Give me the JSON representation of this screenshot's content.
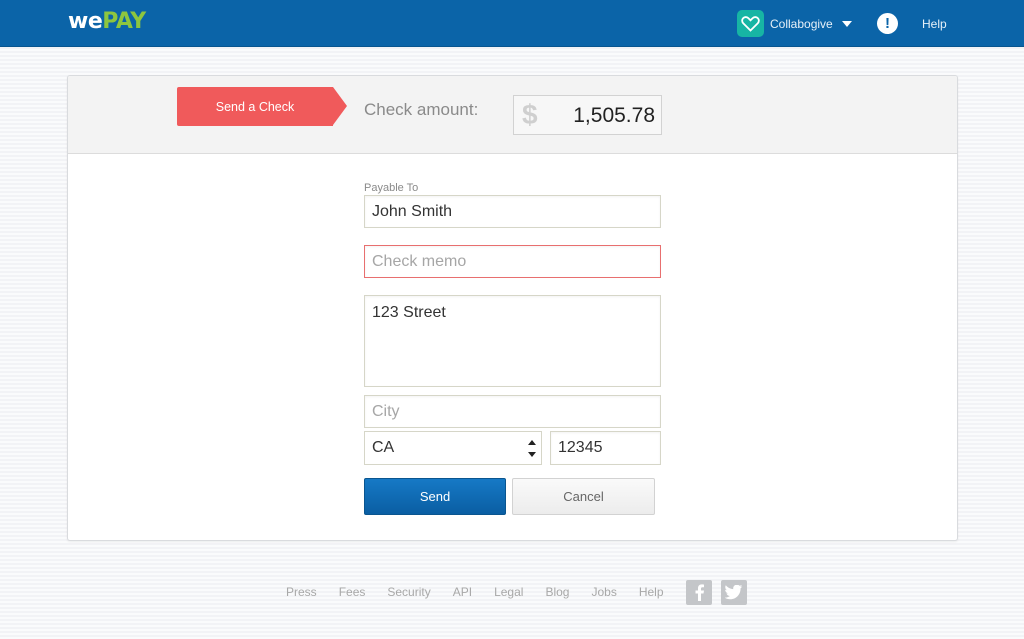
{
  "header": {
    "logo_we": "we",
    "logo_pay": "PAY",
    "account_name": "Collabogive",
    "alert_glyph": "!",
    "help_label": "Help"
  },
  "check": {
    "ribbon_label": "Send a Check",
    "amount_label": "Check amount:",
    "currency_symbol": "$",
    "amount_value": "1,505.78"
  },
  "form": {
    "payable_label": "Payable To",
    "payable_value": "John Smith",
    "memo_value": "",
    "memo_placeholder": "Check memo",
    "address_value": "123 Street",
    "city_value": "",
    "city_placeholder": "City",
    "state_value": "CA",
    "zip_value": "12345",
    "send_label": "Send",
    "cancel_label": "Cancel"
  },
  "footer": {
    "links": [
      "Press",
      "Fees",
      "Security",
      "API",
      "Legal",
      "Blog",
      "Jobs",
      "Help"
    ],
    "social_icons": [
      "facebook-icon",
      "twitter-icon"
    ]
  },
  "colors": {
    "brand_blue": "#0b64a8",
    "brand_green": "#8dc63f",
    "ribbon_red": "#f05a5b",
    "avatar_teal": "#17b5a4"
  }
}
